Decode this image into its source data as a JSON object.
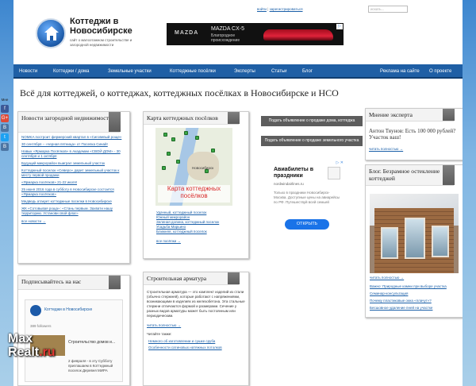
{
  "header": {
    "top_links": [
      "войти",
      "зарегистрироваться"
    ],
    "search_placeholder": "искать...",
    "site_title": "Коттеджи в Новосибирске",
    "site_subtitle": "сайт о малоэтажном строительстве и загородной недвижимости"
  },
  "ad_banner": {
    "brand": "MAZDA",
    "model": "MAZDA CX-5",
    "slogan": "Благородное происхождение"
  },
  "nav": {
    "items": [
      "Новости",
      "Коттеджи / дома",
      "Земельные участки",
      "Коттеджные посёлки",
      "Эксперты",
      "Статьи",
      "Блог"
    ],
    "right_items": [
      "Реклама на сайте",
      "О проекте"
    ]
  },
  "headline": "Всё для коттеджей, о коттеджах, коттеджных посёлках в Новосибирске и НСО",
  "share": {
    "label": "Мне",
    "items": [
      "f",
      "G+",
      "В",
      "t",
      "В"
    ]
  },
  "news_box": {
    "title": "Новости загородной недвижимости",
    "items": [
      "NOMKA построит фермерский квартал в «Сиговевый роще»",
      "30 сентября – «черная пятница» от Поселка Синай!",
      "Навык «Ярмарка Посёлков» в Академии «СВОЙ ДОМ» - 30 сентября и 1 октября",
      "Будущий микрорайон выиграл земельный участок",
      "Коттеджный поселок «Северо» дарит земельный участок к месту первой продажи",
      "«Ярмарка посёлков» 21-22 июля!",
      "25 июня 2016 года в субботу в Новосибирске состоится «Ярмарка посёлков»",
      "Медведь атакует коттеджные поселки в Новосибирске",
      "ЖК «Сотовывая роща»: «Стань первым. Захвати нашу территорию. Установи свой флаг»"
    ],
    "more": "все новости →"
  },
  "subscribe": {
    "title": "Подписывайтесь на нас",
    "page_name": "Коттеджи в Новосибирске",
    "followers": "389 followers"
  },
  "map_box": {
    "title": "Карта коттеджных посёлков",
    "city_label": "Новосибирск",
    "caption": "Карта коттеджных посёлков",
    "links": [
      "Удачный, коттеджный поселок",
      "Южный микрорайон",
      "Зеленая долина, коттеджный поселок",
      "Усадьба Марьино",
      "Ближняя, коттеджный поселок"
    ],
    "more": "все посёлки →"
  },
  "armatura_box": {
    "title": "Строительная арматура",
    "text": "Строительная арматура — это комплект изделий из стали (обычно стержней), которые работают с напряжениями, возникающими в изделиях из железобетона. Эта стальные стержни отличаются формой и размерами. Сечение у разных видов арматуры может быть постоянным или периодическим.",
    "more": "читать полностью →",
    "also_label": "Читайте также:",
    "also": [
      "Немного об изготовлении и сушке сруба",
      "Особенности сатиновых натяжных потолков"
    ]
  },
  "buttons": {
    "house_ad": "Подать объявление о продаже дома, коттеджа",
    "land_ad": "Подать объявление о продаже земельного участка"
  },
  "side_ad": {
    "title": "Авиабилеты в праздники",
    "domain": "nordwindairlines.ru",
    "text": "Только в праздники Новосибирск-Москва. Доступные цены на авиарейсы по РФ. Путешествуй всей семьей",
    "cta": "ОТКРЫТЬ"
  },
  "expert_box": {
    "title": "Мнение эксперта",
    "quote": "Антон Тяунов: Есть 100 000 рублей? Участок ваш!",
    "more": "читать полностью →"
  },
  "blog_box": {
    "title": "Блог. Безрамное остекление коттеджей",
    "more": "читать полностью →",
    "links": [
      "Важно: Природные камни при выборе участка",
      "Семинар-консультация",
      "Почему пластиковые окна «плачут»?",
      "Бесшовное удаление пней на участке"
    ]
  },
  "subscribe_post": {
    "title": "Строительство домов и...",
    "text": "2 февраля - в эту Субботу приглашаем в Коттеджный поселок Деревня МИРА"
  },
  "watermark": {
    "line1": "Max",
    "line2a": "Realt",
    "line2b": ".ru"
  },
  "colors": {
    "nav": "#1f5fa5",
    "link": "#1a5fa8",
    "box_tab": "#5d5d5d"
  }
}
